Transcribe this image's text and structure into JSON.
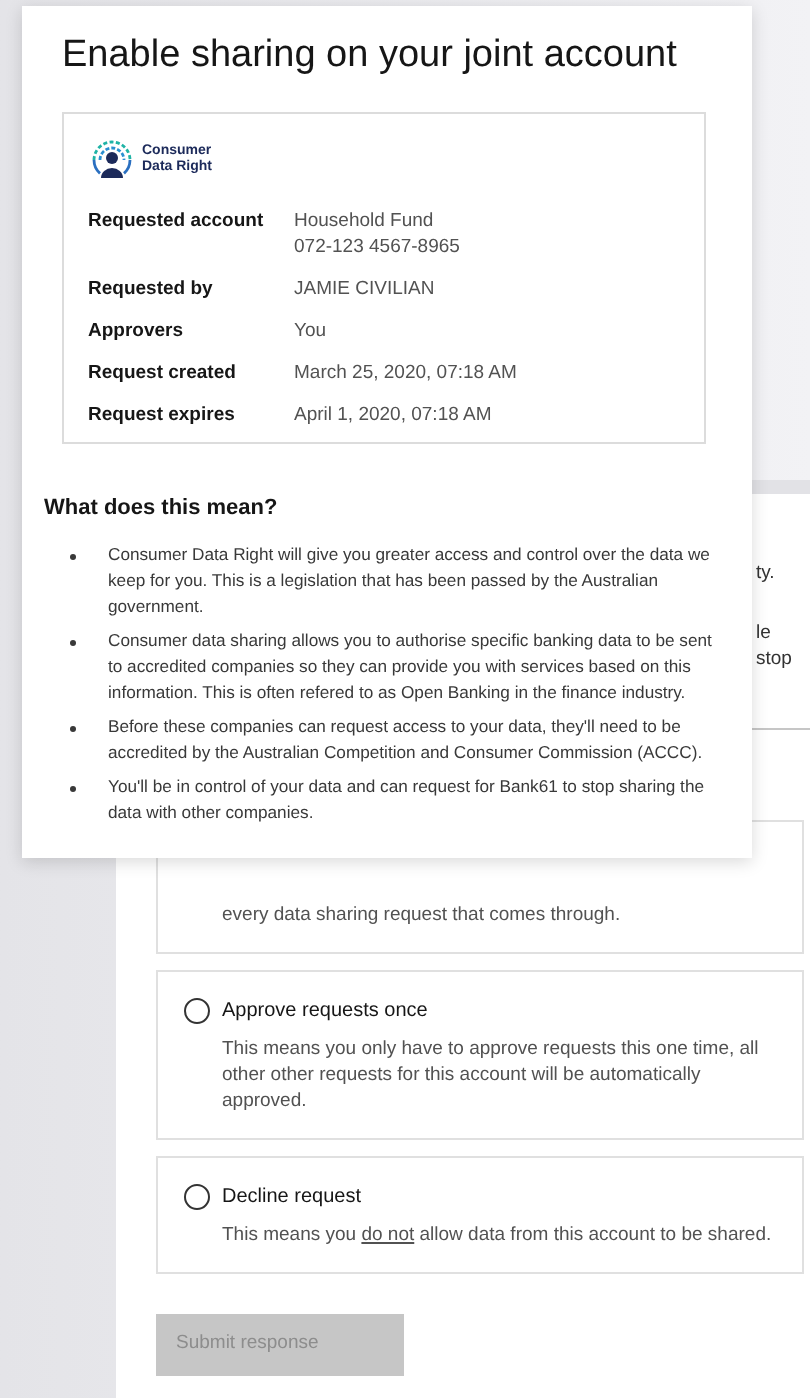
{
  "background_panel": {
    "fragments": [
      "ty.",
      "le",
      "stop"
    ],
    "options": [
      {
        "description": "every data sharing request that comes through."
      },
      {
        "label": "Approve requests once",
        "selected": false,
        "description": "This means you only have to approve requests this one time, all other other requests for this account will be automatically approved."
      },
      {
        "label": "Decline request",
        "selected": false,
        "description_parts": [
          {
            "text": "This means you ",
            "underline": false
          },
          {
            "text": "do not",
            "underline": true
          },
          {
            "text": " allow data from this account to be shared.",
            "underline": false
          }
        ]
      }
    ],
    "submit_button": {
      "label": "Submit response",
      "disabled": true
    }
  },
  "dialog": {
    "title": "Enable sharing on your joint account",
    "logo_text": [
      "Consumer",
      "Data Right"
    ],
    "details": [
      {
        "label": "Requested account",
        "values": [
          "Household Fund",
          "072-123 4567-8965"
        ]
      },
      {
        "label": "Requested by",
        "values": [
          "JAMIE CIVILIAN"
        ]
      },
      {
        "label": "Approvers",
        "values": [
          "You"
        ]
      },
      {
        "label": "Request created",
        "values": [
          "March 25, 2020, 07:18 AM"
        ]
      },
      {
        "label": "Request expires",
        "values": [
          "April 1, 2020, 07:18 AM"
        ]
      }
    ],
    "heading": "What does this mean?",
    "bullets": [
      "Consumer Data Right will give you greater access and control over the data we keep for you. This is a legislation that has been passed by the Australian government.",
      "Consumer data sharing allows you to authorise specific banking data to be sent to accredited companies so they can provide you with services based on this information. This is often refered to as Open Banking in the finance industry.",
      "Before these companies can request access to your data, they'll need to be accredited by the Australian Competition and Consumer Commission (ACCC).",
      "You'll be in control of your data and can request for Bank61 to stop sharing the data with other companies."
    ]
  }
}
